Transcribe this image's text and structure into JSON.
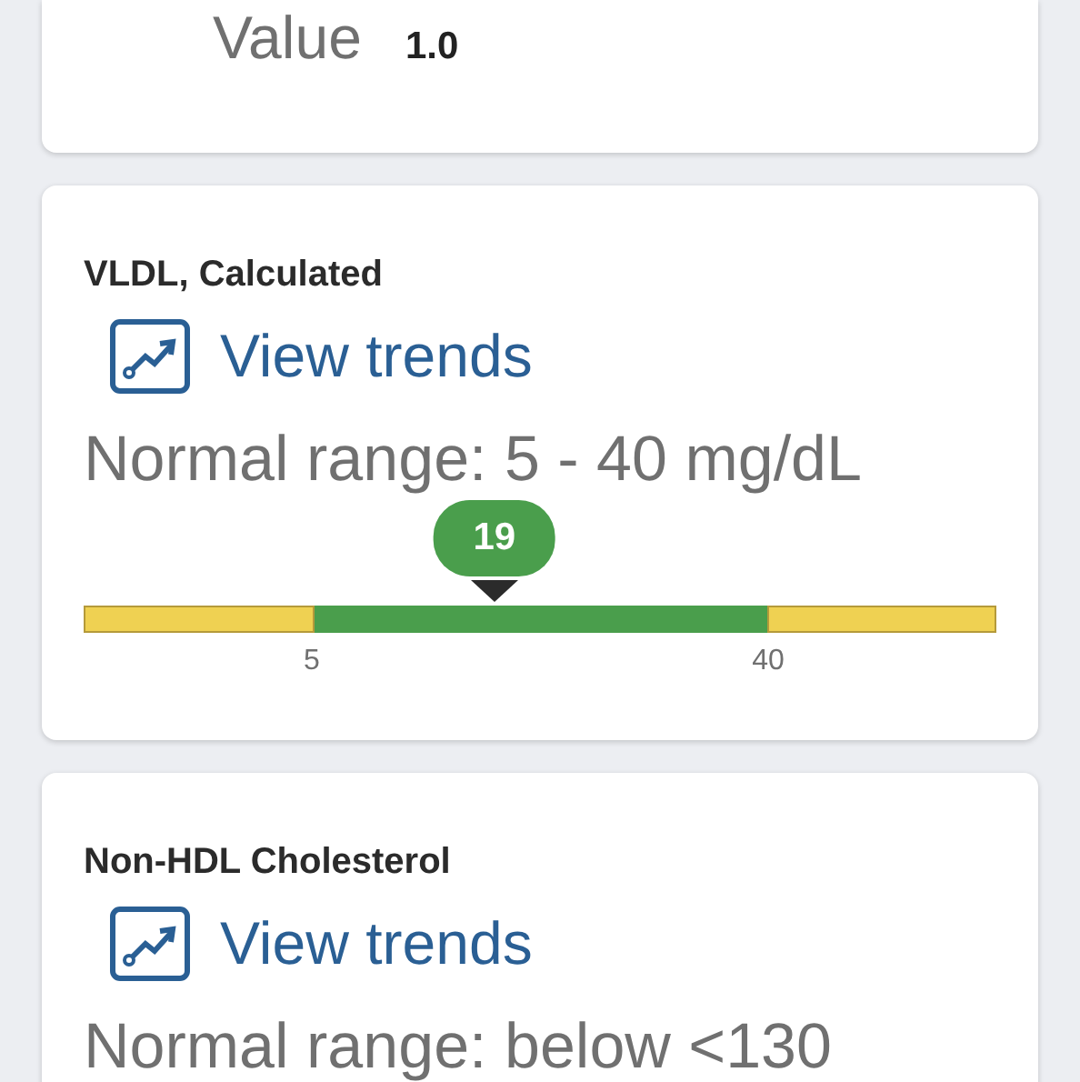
{
  "top_card": {
    "label": "Value",
    "value": "1.0"
  },
  "results": [
    {
      "title": "VLDL, Calculated",
      "link": "View trends",
      "range": "Normal range: 5 - 40 mg/dL",
      "gauge": {
        "reading": "19",
        "level": 0.45,
        "low_tick": "5",
        "high_tick": "40"
      }
    },
    {
      "title": "Non-HDL Cholesterol",
      "link": "View trends",
      "range": "Normal range: below <130"
    }
  ]
}
